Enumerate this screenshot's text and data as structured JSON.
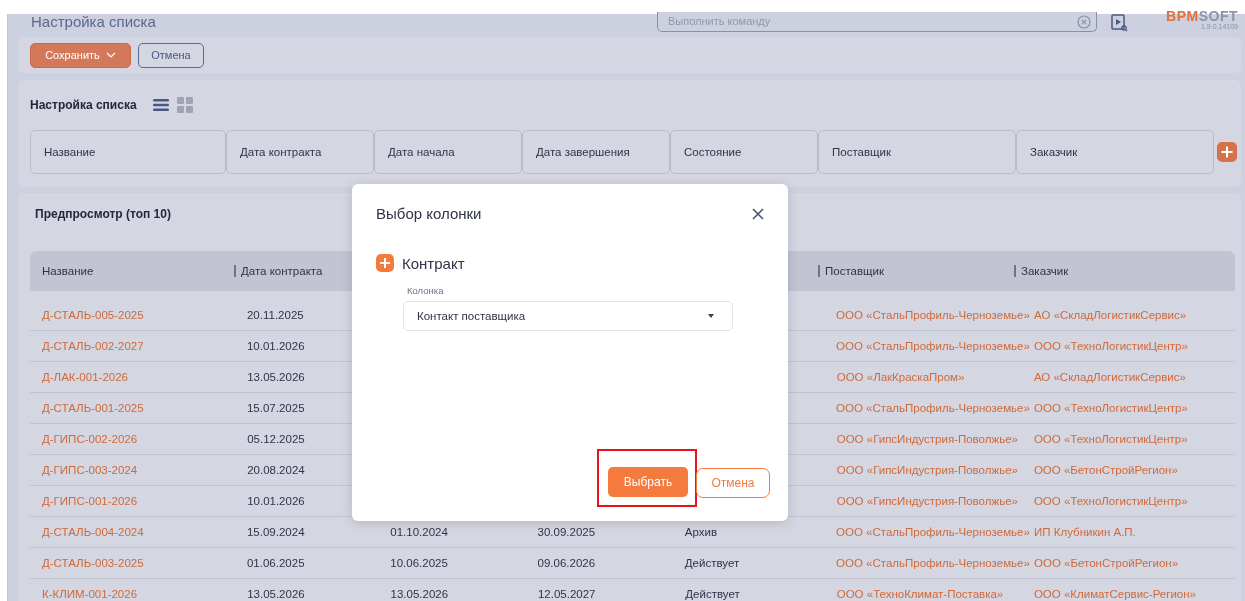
{
  "header": {
    "title": "Настройка списка",
    "command": {
      "placeholder": "Выполнить команду"
    },
    "logo": {
      "brand": "BPM",
      "rest": "SOFT"
    },
    "version": "1.9.0.14109"
  },
  "toolbar": {
    "save": "Сохранить",
    "cancel": "Отмена"
  },
  "setup": {
    "title": "Настройка списка",
    "columns": [
      "Название",
      "Дата контракта",
      "Дата начала",
      "Дата завершения",
      "Состояние",
      "Поставщик",
      "Заказчик"
    ]
  },
  "preview": {
    "title": "Предпросмотр (топ 10)",
    "columns": [
      {
        "label": "Название"
      },
      {
        "label": "Дата контракта"
      },
      {},
      {},
      {},
      {
        "label": "Поставщик"
      },
      {
        "label": "Заказчик"
      }
    ],
    "rows": [
      {
        "name": "Д-СТАЛЬ-005-2025",
        "contract_date": "20.11.2025",
        "supplier": "ООО «СтальПрофиль-Черноземье»",
        "customer": "АО «СкладЛогистикСервис»"
      },
      {
        "name": "Д-СТАЛЬ-002-2027",
        "contract_date": "10.01.2026",
        "supplier": "ООО «СтальПрофиль-Черноземье»",
        "customer": "ООО «ТехноЛогистикЦентр»"
      },
      {
        "name": "Д-ЛАК-001-2026",
        "contract_date": "13.05.2026",
        "supplier": "ООО «ЛакКраскаПром»",
        "customer": "АО «СкладЛогистикСервис»"
      },
      {
        "name": "Д-СТАЛЬ-001-2025",
        "contract_date": "15.07.2025",
        "supplier": "ООО «СтальПрофиль-Черноземье»",
        "customer": "ООО «ТехноЛогистикЦентр»"
      },
      {
        "name": "Д-ГИПС-002-2026",
        "contract_date": "05.12.2025",
        "supplier": "ООО «ГипсИндустрия-Поволжье»",
        "customer": "ООО «ТехноЛогистикЦентр»"
      },
      {
        "name": "Д-ГИПС-003-2024",
        "contract_date": "20.08.2024",
        "supplier": "ООО «ГипсИндустрия-Поволжье»",
        "customer": "ООО «БетонСтройРегион»"
      },
      {
        "name": "Д-ГИПС-001-2026",
        "contract_date": "10.01.2026",
        "supplier": "ООО «ГипсИндустрия-Поволжье»",
        "customer": "ООО «ТехноЛогистикЦентр»"
      },
      {
        "name": "Д-СТАЛЬ-004-2024",
        "contract_date": "15.09.2024",
        "start": "01.10.2024",
        "end": "30.09.2025",
        "status": "Архив",
        "supplier": "ООО «СтальПрофиль-Черноземье»",
        "customer": "ИП Клубникин А.П."
      },
      {
        "name": "Д-СТАЛЬ-003-2025",
        "contract_date": "01.06.2025",
        "start": "10.06.2025",
        "end": "09.06.2026",
        "status": "Действует",
        "supplier": "ООО «СтальПрофиль-Черноземье»",
        "customer": "ООО «БетонСтройРегион»"
      },
      {
        "name": "К-КЛИМ-001-2026",
        "contract_date": "13.05.2026",
        "start": "13.05.2026",
        "end": "12.05.2027",
        "status": "Действует",
        "supplier": "ООО «ТехноКлимат-Поставка»",
        "customer": "ООО «КлиматСервис-Регион»"
      }
    ]
  },
  "dialog": {
    "title": "Выбор колонки",
    "section": "Контракт",
    "field": {
      "label": "Колонка",
      "value": "Контакт поставщика"
    },
    "buttons": [
      {
        "kind": "primary",
        "label": "Выбрать",
        "highlighted": true
      },
      {
        "kind": "secondary",
        "label": "Отмена",
        "highlighted": false
      }
    ]
  }
}
